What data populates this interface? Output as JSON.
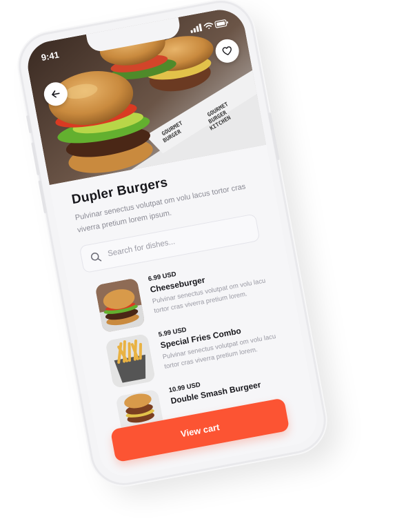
{
  "status": {
    "time": "9:41"
  },
  "restaurant": {
    "name": "Dupler Burgers",
    "description": "Pulvinar senectus volutpat om volu lacus tortor cras viverra pretium lorem ipsum."
  },
  "search": {
    "placeholder": "Search for dishes..."
  },
  "menu": [
    {
      "price": "6.99 USD",
      "name": "Cheeseburger",
      "description": "Pulvinar senectus volutpat om volu lacu tortor cras viverra pretium lorem."
    },
    {
      "price": "5.99 USD",
      "name": "Special Fries Combo",
      "description": "Pulvinar senectus volutpat om volu lacu tortor cras viverra pretium lorem."
    },
    {
      "price": "10.99 USD",
      "name": "Double Smash Burgeer",
      "description": ""
    }
  ],
  "cart": {
    "label": "View cart"
  },
  "icons": {
    "back": "arrow-left-icon",
    "favorite": "heart-icon",
    "search": "search-icon",
    "signal": "signal-icon",
    "wifi": "wifi-icon",
    "battery": "battery-icon"
  },
  "colors": {
    "accent": "#fc5433",
    "title": "#17171c",
    "muted": "#8a8a94",
    "background": "#f6f6f8"
  }
}
